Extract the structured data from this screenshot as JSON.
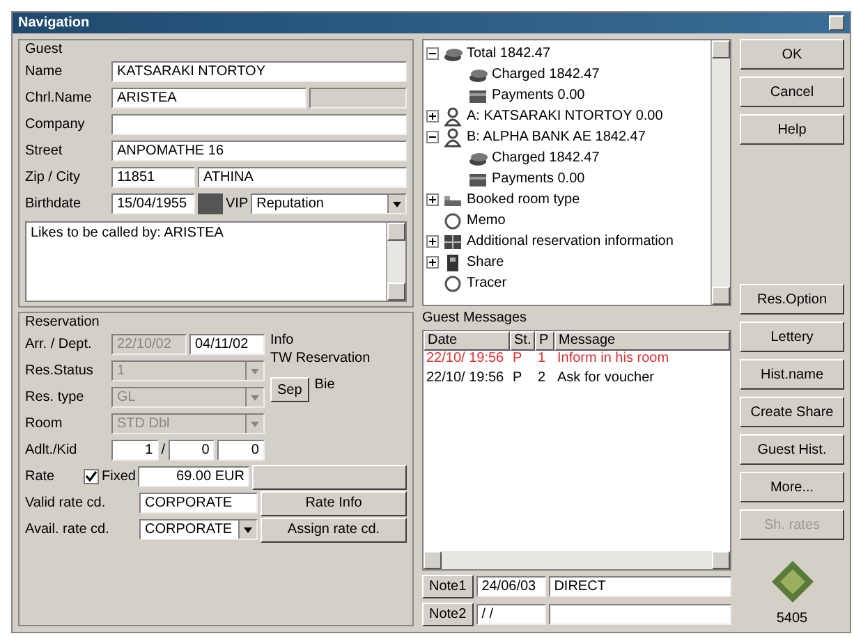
{
  "window": {
    "title": "Navigation"
  },
  "guest": {
    "title": "Guest",
    "name": {
      "label": "Name",
      "value": "KATSARAKI NTORTOY"
    },
    "christian_name": {
      "label": "Chrl.Name",
      "value": "ARISTEA"
    },
    "company": {
      "label": "Company"
    },
    "street": {
      "label": "Street",
      "value": "ANPOMATHE 16"
    },
    "zip_city": {
      "label": "Zip / City",
      "zip": "11851",
      "city": "ATHINA"
    },
    "birthdate": {
      "label": "Birthdate",
      "value": "15/04/1955",
      "vip": "VIP",
      "reputation": "Reputation"
    },
    "memo": "Likes to be called by: ARISTEA"
  },
  "tree": [
    {
      "kind": "coins",
      "label": "Total 1842.47",
      "expanded": true,
      "children": [
        {
          "kind": "coins",
          "label": "Charged 1842.47"
        },
        {
          "kind": "card",
          "label": "Payments 0.00"
        }
      ]
    },
    {
      "kind": "person",
      "label": "A: KATSARAKI NTORTOY 0.00",
      "expanded": false
    },
    {
      "kind": "person",
      "label": "B: ALPHA BANK AE 1842.47",
      "expanded": true,
      "children": [
        {
          "kind": "coins",
          "label": "Charged 1842.47"
        },
        {
          "kind": "card",
          "label": "Payments 0.00"
        }
      ]
    },
    {
      "kind": "bed",
      "label": "Booked room type",
      "expanded": false
    },
    {
      "kind": "note",
      "label": "Memo"
    },
    {
      "kind": "grid",
      "label": "Additional reservation information",
      "expanded": false
    },
    {
      "kind": "share",
      "label": "Share",
      "expanded": false
    },
    {
      "kind": "note",
      "label": "Tracer"
    }
  ],
  "buttons_top": [
    {
      "label": "OK",
      "disabled": false
    },
    {
      "label": "Cancel",
      "disabled": false
    },
    {
      "label": "Help",
      "disabled": false
    }
  ],
  "buttons_side": [
    {
      "label": "Res.Option",
      "disabled": false
    },
    {
      "label": "Lettery",
      "disabled": false
    },
    {
      "label": "Hist.name",
      "disabled": false
    },
    {
      "label": "Create Share",
      "disabled": false
    },
    {
      "label": "Guest Hist.",
      "disabled": false
    },
    {
      "label": "More...",
      "disabled": false
    },
    {
      "label": "Sh. rates",
      "disabled": true
    }
  ],
  "version": "5405",
  "reservation": {
    "title": "Reservation",
    "arrival": {
      "label": "Arr. / Dept.",
      "from": "22/10/02",
      "to": "04/11/02",
      "disabled": true
    },
    "combos": [
      {
        "label": "Res.Status",
        "value": "1",
        "disabled": true
      },
      {
        "label": "Res. type",
        "value": "GL",
        "disabled": true
      },
      {
        "label": "Room",
        "value": "STD Dbl",
        "disabled": true
      }
    ],
    "adults": {
      "label": "Adlt./Kid",
      "adults": "1",
      "sep": "/",
      "kids": "0",
      "extra": "0"
    },
    "rate": {
      "label": "Rate",
      "fixed_label": "Fixed",
      "fixed": true,
      "value": "69.00 EUR"
    },
    "valid_rate": {
      "label": "Valid rate cd.",
      "value": "CORPORATE"
    },
    "avail_rate": {
      "label": "Avail. rate cd.",
      "value": "CORPORATE"
    },
    "info": "Info",
    "tw": "TW Reservation",
    "sep_button": "Sep",
    "sep_label": "Bie",
    "rate_info": "Rate Info",
    "assign_rate": "Assign rate cd."
  },
  "messages": {
    "title": "Guest Messages",
    "columns": [
      "Date",
      "St.",
      "P",
      "Message"
    ],
    "rows": [
      {
        "date": "22/10/ 19:56",
        "status": "P",
        "priority": "1",
        "message": "Inform in his room",
        "color": "#e03030"
      },
      {
        "date": "22/10/ 19:56",
        "status": "P",
        "priority": "2",
        "message": "Ask for voucher",
        "color": "#000000"
      }
    ]
  },
  "notes": [
    {
      "button": "Note1",
      "date": "24/06/03",
      "text": "DIRECT"
    },
    {
      "button": "Note2",
      "date": "/ /"
    }
  ]
}
